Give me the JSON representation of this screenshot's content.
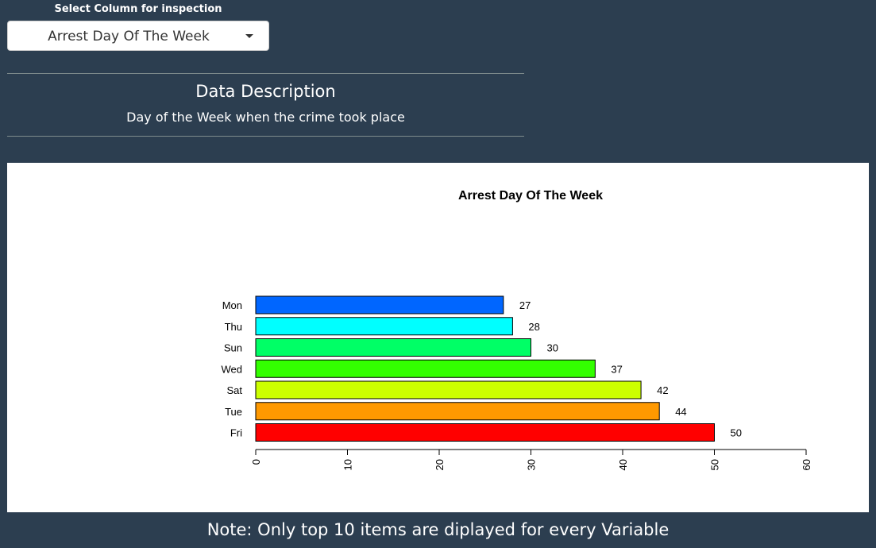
{
  "select": {
    "label": "Select Column for inspection",
    "value": "Arrest Day Of The Week"
  },
  "description": {
    "title": "Data Description",
    "text": "Day of the Week when the crime took place"
  },
  "note": "Note: Only top 10 items are diplayed for every Variable",
  "icons": {
    "dropdown": "caret-down-icon"
  },
  "chart_data": {
    "type": "bar",
    "orientation": "horizontal",
    "title": "Arrest Day Of The Week",
    "categories": [
      "Mon",
      "Thu",
      "Sun",
      "Wed",
      "Sat",
      "Tue",
      "Fri"
    ],
    "values": [
      27,
      28,
      30,
      37,
      42,
      44,
      50
    ],
    "colors": [
      "#0066ff",
      "#00ffff",
      "#00ff66",
      "#33ff00",
      "#ccff00",
      "#ff9900",
      "#ff0000"
    ],
    "xlim": [
      0,
      60
    ],
    "xticks": [
      0,
      10,
      20,
      30,
      40,
      50,
      60
    ],
    "data_labels": true,
    "grid": false
  }
}
